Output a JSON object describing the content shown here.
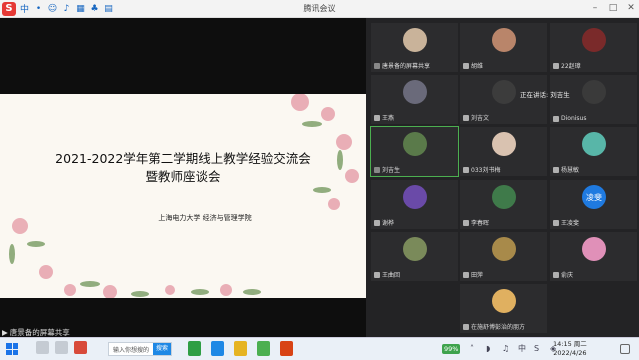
{
  "window": {
    "title": "腾讯会议"
  },
  "ime": {
    "logo": "S",
    "lang": "中"
  },
  "slide": {
    "title_line1": "2021-2022学年第二学期线上教学经验交流会",
    "title_line2": "暨教师座谈会",
    "org": "上海电力大学 经济与管理学院"
  },
  "share_bar": {
    "label": "唐景备的屏幕共享"
  },
  "speaking": {
    "text": "正在讲话: 刘吉生"
  },
  "participants": [
    {
      "name": "唐景备的屏幕共享",
      "avatar_color": "#c9b39a",
      "mic": "on"
    },
    {
      "name": "胡维",
      "avatar_color": "#b9856a",
      "mic": "off"
    },
    {
      "name": "22赵璋",
      "avatar_color": "#7a2a2a",
      "mic": "off"
    },
    {
      "name": "王燕",
      "avatar_color": "#6a6a7a",
      "mic": "off"
    },
    {
      "name": "刘吉文",
      "avatar_color": "#3c3c3c",
      "mic": "off"
    },
    {
      "name": "Dionisus",
      "avatar_color": "#3a3a3a",
      "mic": "off"
    },
    {
      "name": "刘吉生",
      "avatar_color": "#5a7a4a",
      "mic": "on"
    },
    {
      "name": "033刘书梅",
      "avatar_color": "#d9c2b0",
      "mic": "off"
    },
    {
      "name": "杨慧敏",
      "avatar_color": "#58b6a8",
      "mic": "off"
    },
    {
      "name": "谢桦",
      "avatar_color": "#6a4aa8",
      "mic": "off"
    },
    {
      "name": "李春晖",
      "avatar_color": "#3f7a4a",
      "mic": "off"
    },
    {
      "name": "王凌斐",
      "avatar_color": "#1f7ae0",
      "avatar_text": "凌斐",
      "mic": "off"
    },
    {
      "name": "王曲回",
      "avatar_color": "#7a8a5a",
      "mic": "off"
    },
    {
      "name": "田萍",
      "avatar_color": "#a88a4a",
      "mic": "off"
    },
    {
      "name": "俞庆",
      "avatar_color": "#e090b8",
      "mic": "off"
    },
    {
      "name": "在施舒博彭治的朋方",
      "avatar_color": "#e0b060",
      "mic": "off"
    }
  ],
  "taskbar": {
    "search_placeholder": "输入你想搜的",
    "search_button": "搜索",
    "battery": "99%",
    "time": "14:15 周二",
    "date": "2022/4/26"
  },
  "colors": {
    "accent": "#1e88e5",
    "panel": "#232325",
    "slide_bg": "#fbf8f2"
  }
}
